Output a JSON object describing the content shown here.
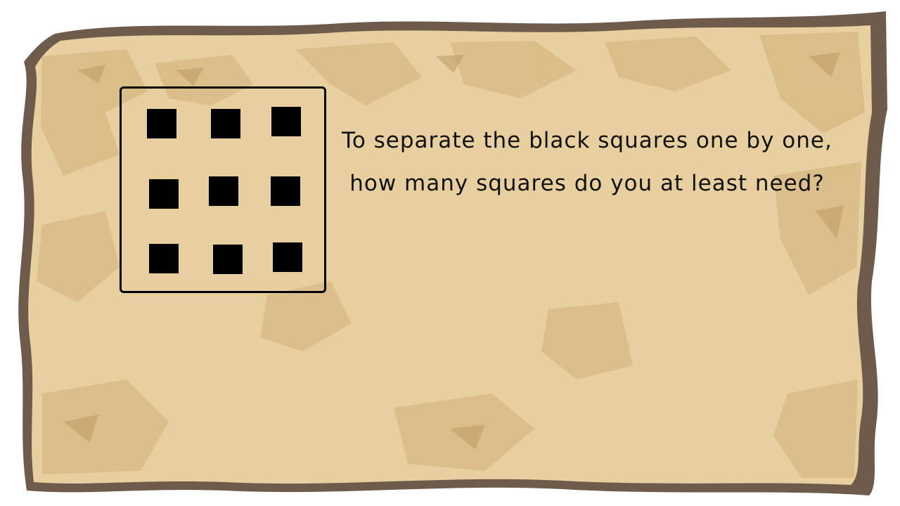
{
  "question": {
    "line1": "To separate the black squares one by one,",
    "line2": "how many squares do you at least need?"
  },
  "puzzle": {
    "black_square_count": 9,
    "layout": "3x3"
  },
  "colors": {
    "parchment_light": "#e8cf9f",
    "parchment_mid": "#d7b884",
    "parchment_dark": "#bb9966",
    "burnt_edge": "#6f5b4b",
    "square": "#000000",
    "text": "#111111"
  }
}
